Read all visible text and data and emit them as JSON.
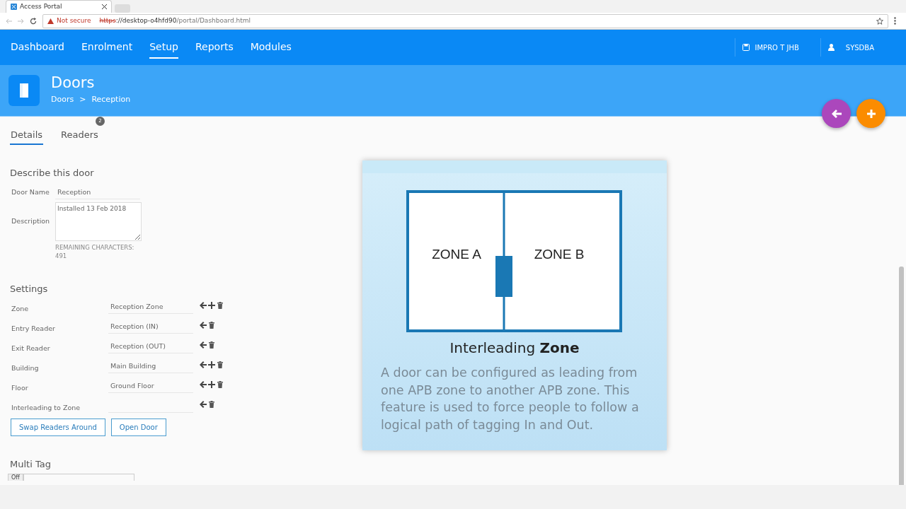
{
  "browser": {
    "tab_title": "Access Portal",
    "security": "Not secure",
    "url_scheme": "https",
    "url_rest": "://desktop-o4hfd90",
    "url_path": "/portal/Dashboard.html"
  },
  "nav": {
    "items": [
      {
        "label": "Dashboard",
        "selected": false
      },
      {
        "label": "Enrolment",
        "selected": false
      },
      {
        "label": "Setup",
        "selected": true
      },
      {
        "label": "Reports",
        "selected": false
      },
      {
        "label": "Modules",
        "selected": false
      }
    ],
    "site": "IMPRO T JHB",
    "user": "SYSDBA"
  },
  "header": {
    "title": "Doors",
    "breadcrumb": [
      "Doors",
      "Reception"
    ],
    "separator": ">"
  },
  "tabs": [
    {
      "label": "Details",
      "selected": true
    },
    {
      "label": "Readers",
      "selected": false,
      "badge": "2"
    }
  ],
  "describe": {
    "heading": "Describe this door",
    "door_name_label": "Door Name",
    "door_name": "Reception",
    "description_label": "Description",
    "description": "Installed 13 Feb 2018",
    "remaining": "REMAINING CHARACTERS: 491"
  },
  "settings": {
    "heading": "Settings",
    "rows": [
      {
        "label": "Zone",
        "value": "Reception Zone",
        "addable": true
      },
      {
        "label": "Entry Reader",
        "value": "Reception (IN)",
        "addable": false
      },
      {
        "label": "Exit Reader",
        "value": "Reception (OUT)",
        "addable": false
      },
      {
        "label": "Building",
        "value": "Main Building",
        "addable": true
      },
      {
        "label": "Floor",
        "value": "Ground Floor",
        "addable": true
      },
      {
        "label": "Interleading to Zone",
        "addable": false
      }
    ],
    "buttons": [
      "Swap Readers Around",
      "Open Door"
    ]
  },
  "multi_tag": {
    "heading": "Multi Tag",
    "toggle": "Off",
    "on": false
  },
  "info_card": {
    "zone_a": "ZONE A",
    "zone_b": "ZONE B",
    "title": "Interleading **Zone**",
    "text": "A door can be configured as leading from one APB zone to another APB zone. This feature is used to force people to follow a logical path of tagging In and Out."
  }
}
